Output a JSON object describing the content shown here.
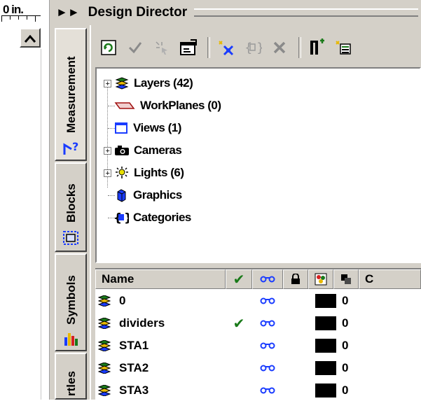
{
  "ruler": {
    "unit_label": "0 in."
  },
  "app": {
    "title": "Design Director"
  },
  "tabs": [
    {
      "label": "Measurement",
      "icon": "measure-icon"
    },
    {
      "label": "Blocks",
      "icon": "blocks-icon"
    },
    {
      "label": "Symbols",
      "icon": "symbols-icon"
    },
    {
      "label": "rtles",
      "icon": ""
    }
  ],
  "toolbar": {
    "buttons": [
      {
        "icon": "refresh-icon"
      },
      {
        "icon": "check-icon"
      },
      {
        "icon": "select-icon"
      },
      {
        "icon": "properties-icon"
      },
      {
        "icon": "new-item-icon"
      },
      {
        "icon": "category-icon"
      },
      {
        "icon": "delete-icon"
      },
      {
        "icon": "add-layer-icon"
      },
      {
        "icon": "layer-options-icon"
      }
    ]
  },
  "tree": {
    "items": [
      {
        "label": "Layers (42)",
        "icon": "layers-icon",
        "expandable": true
      },
      {
        "label": "WorkPlanes (0)",
        "icon": "workplane-icon",
        "expandable": false
      },
      {
        "label": "Views (1)",
        "icon": "views-icon",
        "expandable": false
      },
      {
        "label": "Cameras",
        "icon": "camera-icon",
        "expandable": true
      },
      {
        "label": "Lights (6)",
        "icon": "light-icon",
        "expandable": true
      },
      {
        "label": "Graphics",
        "icon": "graphics-icon",
        "expandable": false
      },
      {
        "label": "Categories",
        "icon": "categories-icon",
        "expandable": false
      }
    ]
  },
  "grid": {
    "columns": [
      {
        "label": "Name"
      },
      {
        "label": "",
        "icon": "active-check-icon"
      },
      {
        "label": "",
        "icon": "visible-link-icon"
      },
      {
        "label": "",
        "icon": "lock-icon"
      },
      {
        "label": "",
        "icon": "color-icon"
      },
      {
        "label": "",
        "icon": "line-icon"
      },
      {
        "label": "C"
      }
    ],
    "rows": [
      {
        "name": "0",
        "active": false,
        "color": "#000000",
        "value": "0"
      },
      {
        "name": "dividers",
        "active": true,
        "color": "#000000",
        "value": "0"
      },
      {
        "name": "STA1",
        "active": false,
        "color": "#000000",
        "value": "0"
      },
      {
        "name": "STA2",
        "active": false,
        "color": "#000000",
        "value": "0"
      },
      {
        "name": "STA3",
        "active": false,
        "color": "#000000",
        "value": "0"
      }
    ]
  },
  "colors": {
    "chrome": "#d4d0c8",
    "check": "#1a7a1a",
    "link": "#1a3cff"
  }
}
